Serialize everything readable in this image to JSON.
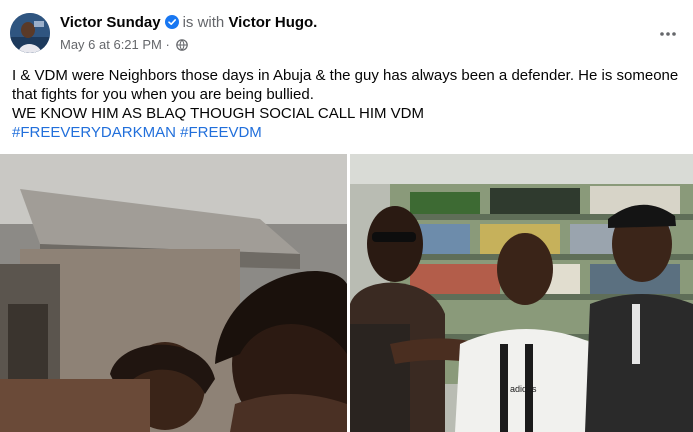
{
  "post": {
    "author": "Victor Sunday",
    "with_text": "is with",
    "tagged_person": "Victor Hugo.",
    "timestamp": "May 6 at 6:21 PM",
    "separator": "·",
    "privacy_icon": "globe-icon",
    "verified_icon": "verified-badge-icon",
    "more_icon": "more-options-icon",
    "text_lines": [
      "I & VDM were Neighbors those days in Abuja & the guy has always been a defender. He is someone that fights for you when you are being bullied.",
      "WE KNOW HIM AS BLAQ THOUGH SOCIAL CALL HIM VDM"
    ],
    "hashtags": [
      "#FREEVERYDARKMAN",
      "#FREEVDM"
    ],
    "jersey_brand": "adidas"
  },
  "colors": {
    "link_blue": "#216fdb",
    "verified_blue": "#1877f2",
    "secondary_text": "#65676b",
    "primary_text": "#050505"
  }
}
